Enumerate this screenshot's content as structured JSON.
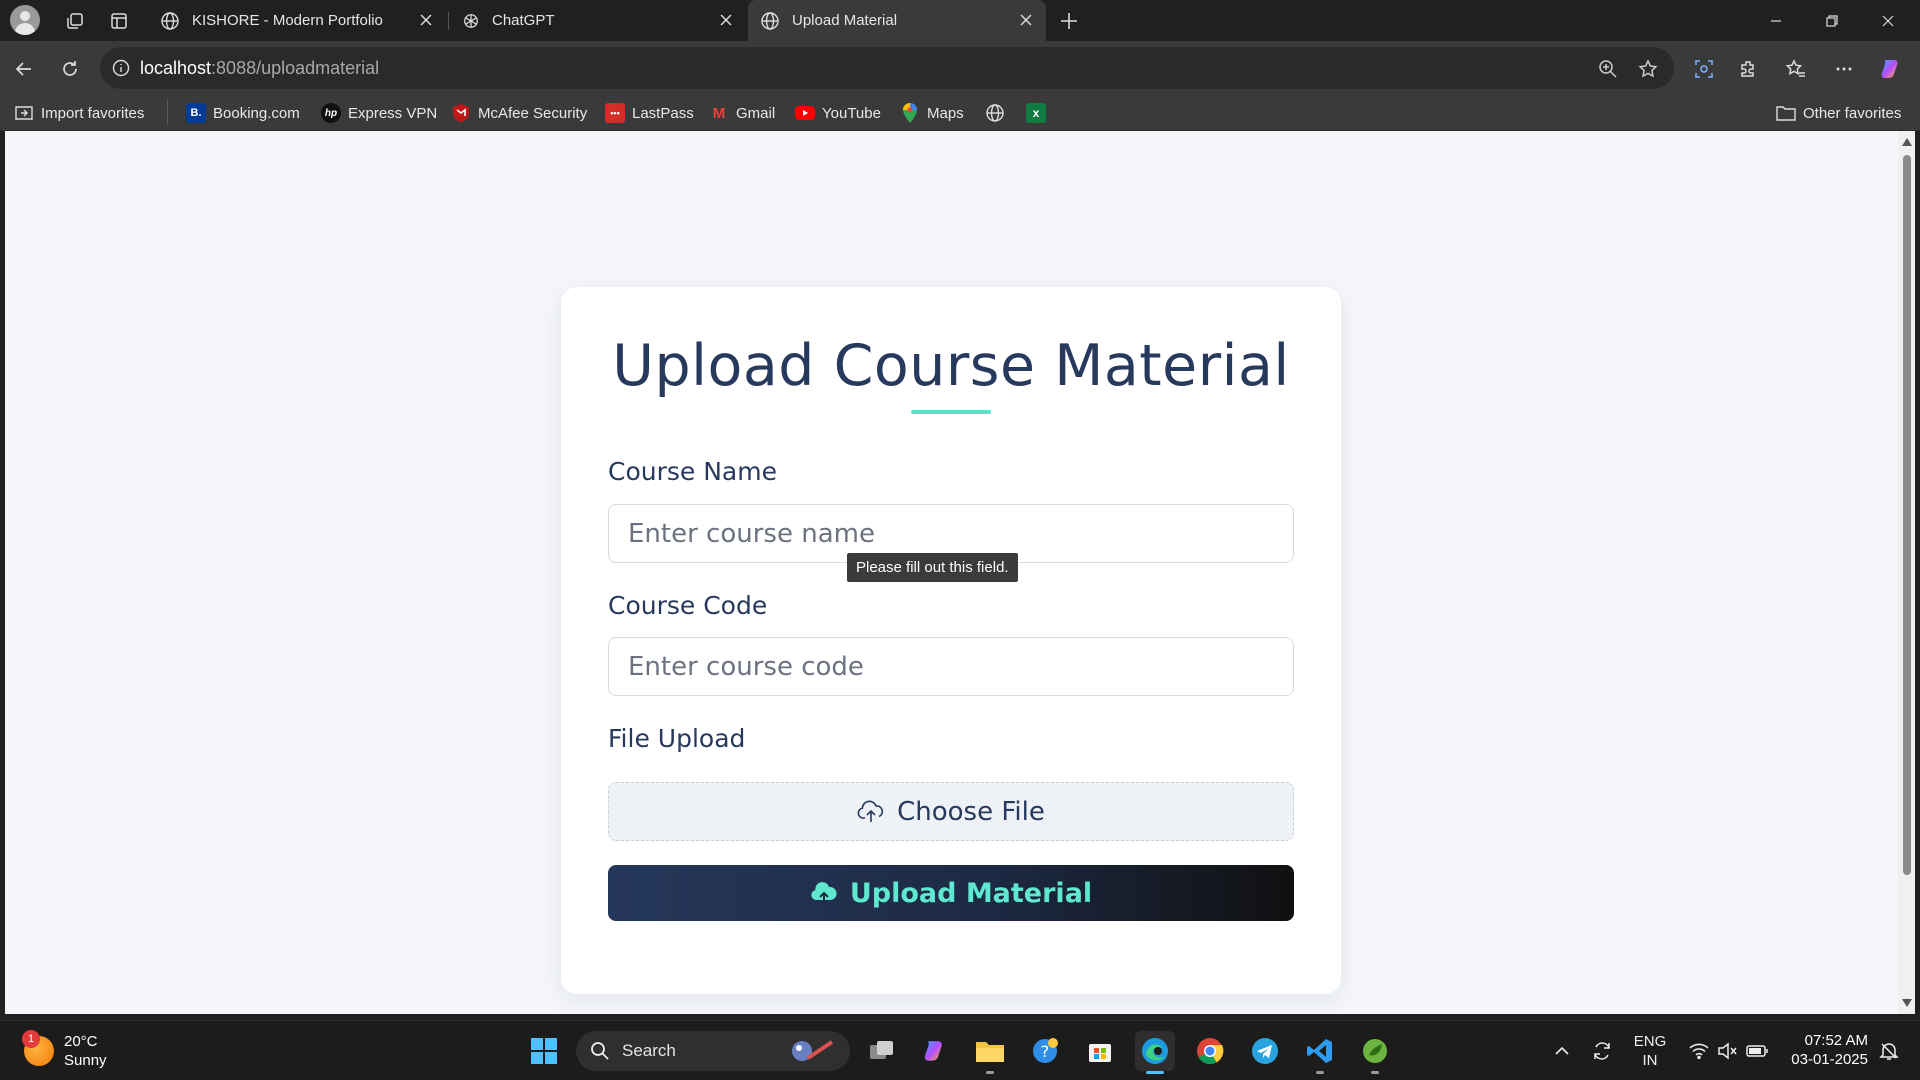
{
  "browser": {
    "tabs": [
      {
        "title": "KISHORE - Modern Portfolio",
        "icon": "globe-icon",
        "active": false
      },
      {
        "title": "ChatGPT",
        "icon": "chatgpt-icon",
        "active": false
      },
      {
        "title": "Upload Material",
        "icon": "globe-icon",
        "active": true
      }
    ],
    "address": {
      "host": "localhost",
      "path": ":8088/uploadmaterial"
    },
    "favorites": [
      {
        "label": "Import favorites",
        "icon": "import-icon"
      },
      {
        "label": "Booking.com",
        "icon": "booking-icon",
        "glyph": "B."
      },
      {
        "label": "Express VPN",
        "icon": "hp-icon",
        "glyph": "hp"
      },
      {
        "label": "McAfee Security",
        "icon": "mcafee-icon"
      },
      {
        "label": "LastPass",
        "icon": "lastpass-icon",
        "glyph": "•••"
      },
      {
        "label": "Gmail",
        "icon": "gmail-icon",
        "glyph": "M"
      },
      {
        "label": "YouTube",
        "icon": "youtube-icon"
      },
      {
        "label": "Maps",
        "icon": "maps-icon"
      },
      {
        "label": "",
        "icon": "globe-icon"
      },
      {
        "label": "",
        "icon": "excel-icon",
        "glyph": "x"
      }
    ],
    "other_favorites": "Other favorites"
  },
  "page": {
    "title": "Upload Course Material",
    "fields": {
      "course_name": {
        "label": "Course Name",
        "placeholder": "Enter course name",
        "value": ""
      },
      "course_code": {
        "label": "Course Code",
        "placeholder": "Enter course code",
        "value": ""
      },
      "file_upload": {
        "label": "File Upload",
        "button": "Choose File"
      }
    },
    "validation_tooltip": "Please fill out this field.",
    "submit_label": "Upload Material",
    "colors": {
      "title": "#27395c",
      "accent": "#5fe0cc",
      "button_text": "#5fe8cf"
    }
  },
  "taskbar": {
    "weather": {
      "temp": "20°C",
      "condition": "Sunny",
      "badge": "1"
    },
    "search_placeholder": "Search",
    "language": {
      "line1": "ENG",
      "line2": "IN"
    },
    "time": "07:52 AM",
    "date": "03-01-2025"
  }
}
